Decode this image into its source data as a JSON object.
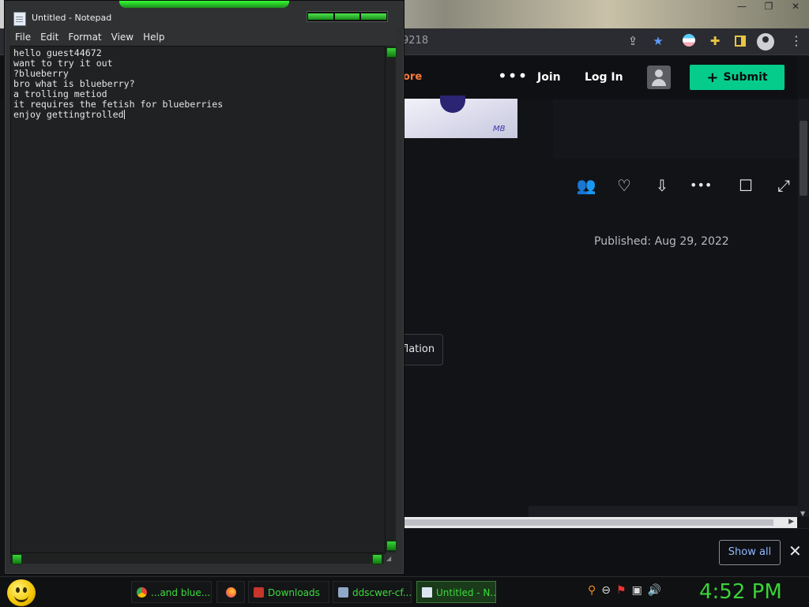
{
  "browser": {
    "window_controls": [
      "—",
      "❐",
      "✕"
    ],
    "url_fragment": "9218",
    "address_icons": [
      "share-icon",
      "star-icon",
      "flag-icon",
      "extensions-icon",
      "sidebar-icon",
      "profile-icon",
      "menu-icon"
    ],
    "nav": {
      "explore_fragment": "ore",
      "more": "•••",
      "join": "Join",
      "login": "Log In",
      "submit_plus": "+",
      "submit": "Submit"
    },
    "thumbnail_signature": "MB",
    "actions": [
      "👥",
      "♡",
      "⇩",
      "•••",
      "☐",
      "⤢"
    ],
    "published": "Published: Aug 29, 2022",
    "tag_fragment": "flation",
    "download_bar": {
      "show_all": "Show all",
      "close": "✕"
    }
  },
  "notepad": {
    "title": "Untitled - Notepad",
    "menu": [
      "File",
      "Edit",
      "Format",
      "View",
      "Help"
    ],
    "lines": [
      "hello guest44672",
      "want to try it out",
      "?blueberry",
      "bro what is blueberry?",
      "a trolling metiod",
      "it requires the fetish for blueberries",
      "enjoy gettingtrolled"
    ]
  },
  "taskbar": {
    "items": [
      {
        "label": "...and blue...",
        "icon": "chrome-icon"
      },
      {
        "label": "",
        "icon": "firefox-icon"
      },
      {
        "label": "Downloads",
        "icon": "folder-icon"
      },
      {
        "label": "ddscwer-cf...",
        "icon": "image-icon"
      },
      {
        "label": "Untitled - N...",
        "icon": "notepad-icon"
      }
    ],
    "tray_icons": [
      "search-icon",
      "minus-icon",
      "flag-icon",
      "network-icon",
      "volume-icon"
    ],
    "clock": "4:52 PM"
  },
  "colors": {
    "accent_green": "#3ddc3d",
    "submit_green": "#05cc8b"
  }
}
